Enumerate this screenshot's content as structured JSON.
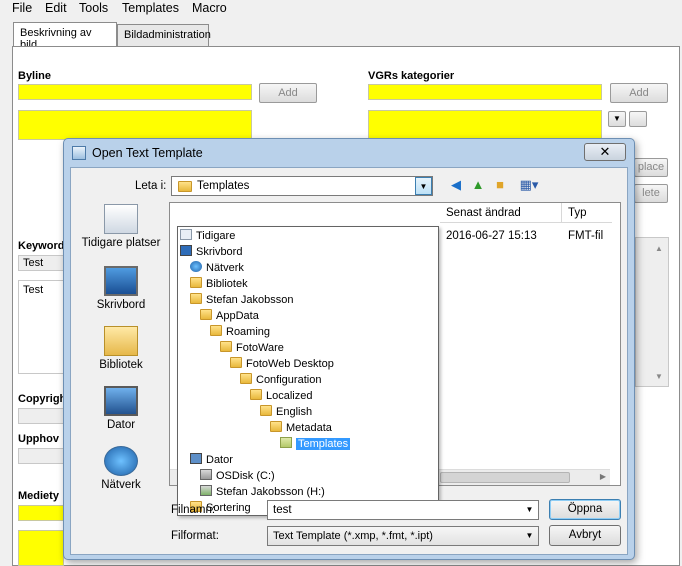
{
  "menu": [
    "File",
    "Edit",
    "Tools",
    "Templates",
    "Macro"
  ],
  "tabs": [
    "Beskrivning av bild",
    "Bildadministration"
  ],
  "app": {
    "byline_label": "Byline",
    "byline_add": "Add",
    "vgr_label": "VGRs kategorier",
    "vgr_add": "Add",
    "keyword_label": "Keyword",
    "keyword_value": "Test",
    "keyword_list_item": "Test",
    "copyright_label": "Copyrigh",
    "upphov_label": "Upphov",
    "mediety_label": "Mediety",
    "replace_btn": "place",
    "delete_btn": "lete"
  },
  "dialog": {
    "title": "Open Text Template",
    "close_glyph": "✕",
    "look_in_label": "Leta i:",
    "look_in_value": "Templates",
    "places": [
      {
        "label": "Tidigare platser",
        "icon": "recent-places-icon"
      },
      {
        "label": "Skrivbord",
        "icon": "desktop-icon"
      },
      {
        "label": "Bibliotek",
        "icon": "libraries-icon"
      },
      {
        "label": "Dator",
        "icon": "computer-icon"
      },
      {
        "label": "Nätverk",
        "icon": "network-icon"
      }
    ],
    "columns": [
      "Senast ändrad",
      "Typ"
    ],
    "file_row": {
      "modified": "2016-06-27 15:13",
      "type": "FMT-fil"
    },
    "tree": [
      "Tidigare",
      "Skrivbord",
      "Nätverk",
      "Bibliotek",
      "Stefan Jakobsson",
      "AppData",
      "Roaming",
      "FotoWare",
      "FotoWeb Desktop",
      "Configuration",
      "Localized",
      "English",
      "Metadata",
      "Templates",
      "Dator",
      "OSDisk (C:)",
      "Stefan Jakobsson (H:)",
      "Sortering"
    ],
    "filename_label": "Filnamn:",
    "filename_value": "test",
    "format_label": "Filformat:",
    "format_value": "Text Template (*.xmp, *.fmt, *.ipt)",
    "open_btn": "Öppna",
    "cancel_btn": "Avbryt"
  },
  "colors": {
    "field_yellow": "#ffff00",
    "selection": "#3399ff",
    "title_bar": "#b9d1ea"
  }
}
